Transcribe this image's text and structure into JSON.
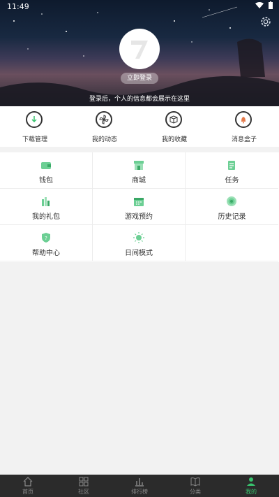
{
  "status": {
    "time": "11:49"
  },
  "profile": {
    "login_button": "立即登录",
    "login_hint": "登录后，个人的信息都会展示在这里"
  },
  "quick": [
    {
      "label": "下载管理",
      "icon": "download-icon"
    },
    {
      "label": "我的动态",
      "icon": "pinwheel-icon"
    },
    {
      "label": "我的收藏",
      "icon": "box-icon"
    },
    {
      "label": "消息盒子",
      "icon": "bell-icon"
    }
  ],
  "grid": [
    {
      "label": "钱包",
      "icon": "wallet-icon"
    },
    {
      "label": "商城",
      "icon": "store-icon"
    },
    {
      "label": "任务",
      "icon": "task-icon"
    },
    {
      "label": "我的礼包",
      "icon": "gift-icon"
    },
    {
      "label": "游戏预约",
      "icon": "calendar-icon"
    },
    {
      "label": "历史记录",
      "icon": "history-icon"
    },
    {
      "label": "帮助中心",
      "icon": "shield-help-icon"
    },
    {
      "label": "日间模式",
      "icon": "sun-icon"
    }
  ],
  "nav": [
    {
      "label": "首页",
      "icon": "home-icon"
    },
    {
      "label": "社区",
      "icon": "grid-icon"
    },
    {
      "label": "排行榜",
      "icon": "chart-icon"
    },
    {
      "label": "分类",
      "icon": "book-icon"
    },
    {
      "label": "我的",
      "icon": "person-icon",
      "active": true
    }
  ],
  "colors": {
    "accent": "#38c46e",
    "nav_bg": "#2b2b2b"
  }
}
